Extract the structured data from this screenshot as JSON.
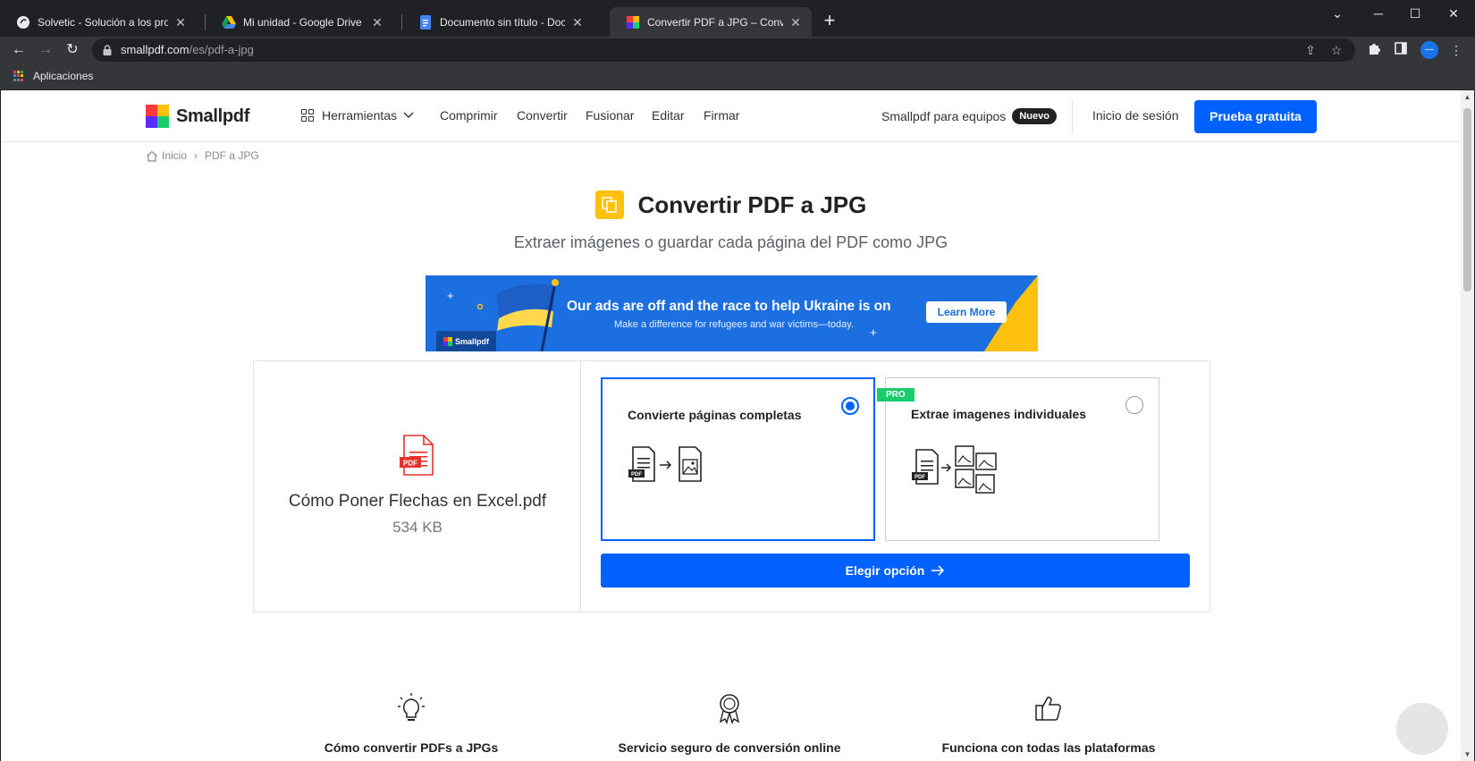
{
  "browser": {
    "tabs": [
      {
        "title": "Solvetic - Solución a los problemas",
        "icon": "solvetic-icon",
        "active": false
      },
      {
        "title": "Mi unidad - Google Drive",
        "icon": "google-drive-icon",
        "active": false
      },
      {
        "title": "Documento sin título - Document",
        "icon": "google-docs-icon",
        "active": false
      },
      {
        "title": "Convertir PDF a JPG – Convierte",
        "icon": "smallpdf-icon",
        "active": true
      }
    ],
    "url_host": "smallpdf.com",
    "url_path": "/es/pdf-a-jpg",
    "bookmarks": [
      {
        "label": "Aplicaciones",
        "icon": "apps-grid-icon"
      }
    ],
    "profile_initial": "—"
  },
  "header": {
    "logo_text": "Smallpdf",
    "nav": {
      "tools": "Herramientas",
      "compress": "Comprimir",
      "convert": "Convertir",
      "merge": "Fusionar",
      "edit": "Editar",
      "sign": "Firmar"
    },
    "teams_label": "Smallpdf para equipos",
    "teams_badge": "Nuevo",
    "login": "Inicio de sesión",
    "cta": "Prueba gratuita"
  },
  "breadcrumb": {
    "home": "Inicio",
    "current": "PDF a JPG"
  },
  "main": {
    "title": "Convertir PDF a JPG",
    "subtitle": "Extraer imágenes o guardar cada página del PDF como JPG"
  },
  "banner": {
    "headline": "Our ads are off and the race to help Ukraine is on",
    "subtext": "Make a difference for refugees and war victims—today.",
    "button": "Learn More",
    "logo": "Smallpdf"
  },
  "file": {
    "name": "Cómo Poner Flechas en Excel.pdf",
    "size": "534 KB",
    "icon_label": "PDF"
  },
  "options": [
    {
      "label": "Convierte páginas completas",
      "selected": true,
      "pro": false
    },
    {
      "label": "Extrae imagenes individuales",
      "selected": false,
      "pro": true,
      "badge": "PRO"
    }
  ],
  "choose_button": "Elegir opción",
  "features": [
    {
      "text": "Cómo convertir PDFs a JPGs",
      "icon": "lightbulb-icon"
    },
    {
      "text": "Servicio seguro de conversión online",
      "icon": "award-ribbon-icon"
    },
    {
      "text": "Funciona con todas las plataformas",
      "icon": "thumbs-up-icon"
    }
  ],
  "colors": {
    "primary": "#0061fe",
    "tool_accent": "#ffc10e",
    "pro_badge": "#19cc6b",
    "banner": "#1b6fe0"
  }
}
